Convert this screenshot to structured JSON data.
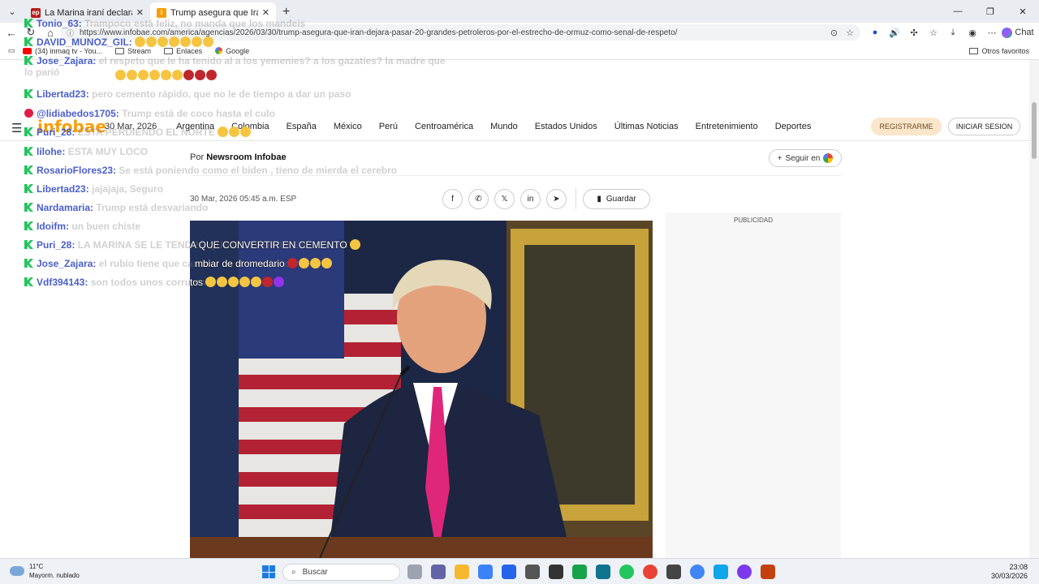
{
  "browser": {
    "tabs": [
      {
        "title": "La Marina iraní declara que el golfo",
        "favicon_text": "ep",
        "active": false
      },
      {
        "title": "Trump asegura que Irán dejará pasar",
        "active": true
      }
    ],
    "new_tab_label": "+",
    "url": "https://www.infobae.com/america/agencias/2026/03/30/trump-asegura-que-iran-dejara-pasar-20-grandes-petroleros-por-el-estrecho-de-ormuz-como-senal-de-respeto/",
    "chat_label": "Chat",
    "bookmarks": [
      {
        "label": "(34) inmaq tv - You...",
        "icon": "youtube-icon"
      },
      {
        "label": "Stream",
        "icon": "folder-icon"
      },
      {
        "label": "Enlaces",
        "icon": "folder-icon"
      },
      {
        "label": "Google",
        "icon": "google-icon"
      }
    ],
    "other_favorites": "Otros favoritos"
  },
  "site": {
    "logo": "infobae",
    "date": "30 Mar, 2026",
    "nav": [
      "Argentina",
      "Colombia",
      "España",
      "México",
      "Perú",
      "Centroamérica",
      "Mundo",
      "Estados Unidos",
      "Últimas Noticias",
      "Entretenimiento",
      "Deportes"
    ],
    "register": "REGISTRARME",
    "login": "INICIAR SESION"
  },
  "article": {
    "by_prefix": "Por",
    "author": "Newsroom Infobae",
    "follow_label": "Seguir en",
    "timestamp": "30 Mar, 2026 05:45 a.m. ESP",
    "save_label": "Guardar",
    "ad_label": "PUBLICIDAD"
  },
  "chat": [
    {
      "user": "Tonio_63",
      "msg": "Trampoco está feliz, no manda que los mandeis",
      "platform": "kick"
    },
    {
      "user": "DAVID_MUNOZ_GIL",
      "msg": "",
      "platform": "kick"
    },
    {
      "user": "Jose_Zajara",
      "msg": "el respeto que le ha tenido al a los yemenies? a los gazatíes? la madre que lo parió",
      "platform": "kick"
    },
    {
      "user": "Libertad23",
      "msg": "pero cemento rápido, que no le de tiempo a dar un paso",
      "platform": "kick"
    },
    {
      "user": "@lidiabedos1705",
      "msg": "Trump está de coco hasta el culo",
      "platform": "youtube"
    },
    {
      "user": "Puri_28",
      "msg": "ESTA PERDIENDO EL NORTE",
      "platform": "kick"
    },
    {
      "user": "lilohe",
      "msg": "ESTA MUY LOCO",
      "platform": "kick"
    },
    {
      "user": "RosarioFlores23",
      "msg": "Se está poniendo como el biden , tieno de mierda el cerebro",
      "platform": "kick"
    },
    {
      "user": "Libertad23",
      "msg": "jajajaja, Seguro",
      "platform": "kick"
    },
    {
      "user": "Nardamaria",
      "msg": "Trump está desvariando",
      "platform": "kick"
    },
    {
      "user": "Idoifm",
      "msg": "un buen chiste",
      "platform": "kick"
    },
    {
      "user": "Puri_28",
      "msg": "LA MARINA SE LE TENDRÁ QUE CONVERTIR EN CEMENTO",
      "platform": "kick"
    },
    {
      "user": "Jose_Zajara",
      "msg": "el rubio tiene que cambiar de dromedario",
      "platform": "kick"
    },
    {
      "user": "Vdf394143",
      "msg": "son todos unos corruptos",
      "platform": "kick"
    }
  ],
  "chat_overlay_bright": [
    "A QUE CONVERTIR EN CEMENTO",
    "mbiar de dromedario",
    "tos"
  ],
  "taskbar": {
    "temp": "11°C",
    "weather": "Mayorm. nublado",
    "search_placeholder": "Buscar",
    "time": "23:08",
    "date": "30/03/2026"
  }
}
